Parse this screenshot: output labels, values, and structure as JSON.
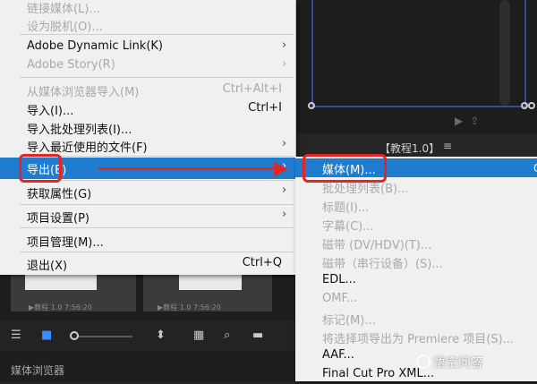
{
  "main_menu": {
    "items": [
      {
        "label": "链接媒体(L)...",
        "shortcut": "",
        "disabled": true,
        "submenu": false
      },
      {
        "label": "设为脱机(O)...",
        "shortcut": "",
        "disabled": true,
        "submenu": false
      },
      {
        "label": "Adobe Dynamic Link(K)",
        "shortcut": "",
        "disabled": false,
        "submenu": true
      },
      {
        "label": "Adobe Story(R)",
        "shortcut": "",
        "disabled": true,
        "submenu": true
      },
      {
        "label": "从媒体浏览器导入(M)",
        "shortcut": "Ctrl+Alt+I",
        "disabled": true,
        "submenu": false
      },
      {
        "label": "导入(I)...",
        "shortcut": "Ctrl+I",
        "disabled": false,
        "submenu": false
      },
      {
        "label": "导入批处理列表(I)...",
        "shortcut": "",
        "disabled": false,
        "submenu": false
      },
      {
        "label": "导入最近使用的文件(F)",
        "shortcut": "",
        "disabled": false,
        "submenu": true
      },
      {
        "label": "导出(E)",
        "shortcut": "",
        "disabled": false,
        "submenu": true,
        "highlighted": true
      },
      {
        "label": "获取属性(G)",
        "shortcut": "",
        "disabled": false,
        "submenu": true
      },
      {
        "label": "项目设置(P)",
        "shortcut": "",
        "disabled": false,
        "submenu": true
      },
      {
        "label": "项目管理(M)...",
        "shortcut": "",
        "disabled": false,
        "submenu": false
      },
      {
        "label": "退出(X)",
        "shortcut": "Ctrl+Q",
        "disabled": false,
        "submenu": false
      }
    ]
  },
  "export_submenu": {
    "items": [
      {
        "label": "媒体(M)...",
        "disabled": false,
        "highlighted": true
      },
      {
        "label": "批处理列表(B)...",
        "disabled": true
      },
      {
        "label": "标题(I)...",
        "disabled": true
      },
      {
        "label": "字幕(C)...",
        "disabled": true
      },
      {
        "label": "磁带 (DV/HDV)(T)...",
        "disabled": true
      },
      {
        "label": "磁带（串行设备）(S)...",
        "disabled": true
      },
      {
        "label": "EDL...",
        "disabled": false
      },
      {
        "label": "OMF...",
        "disabled": true
      },
      {
        "label": "标记(M)...",
        "disabled": true
      },
      {
        "label": "将选择项导出为 Premiere 项目(S)...",
        "disabled": true
      },
      {
        "label": "AAF...",
        "disabled": false
      },
      {
        "label": "Final Cut Pro XML...",
        "disabled": false
      }
    ],
    "extra_char": "C"
  },
  "sequence_tab": {
    "label": "【教程1.0】",
    "menu_icon": "≡"
  },
  "media_browser": {
    "label": "媒体浏览器",
    "thumb_labels": [
      "▶教程 1.0  7:56:20",
      "▶教程 1.0  7:56:20"
    ]
  },
  "watermark": {
    "text": "悟空问答"
  },
  "colors": {
    "highlight": "#1f7ccf",
    "annotation_red": "#e52525",
    "menu_bg": "#f0f0f0"
  },
  "icons": {
    "submenu": "chevron-right-icon",
    "toolbar": [
      "list-view-icon",
      "icon-view-icon",
      "zoom-slider",
      "sort-icon",
      "new-bin-icon",
      "search-icon",
      "folder-icon"
    ]
  }
}
